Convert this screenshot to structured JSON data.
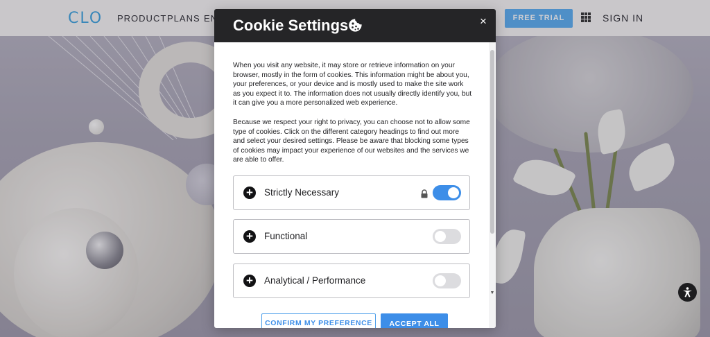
{
  "nav": {
    "logo": "CLO",
    "links": [
      "PRODUCT",
      "PLANS",
      "EN"
    ],
    "free_trial": "FREE TRIAL",
    "sign_in": "SIGN IN"
  },
  "modal": {
    "title": "Cookie Settings",
    "close": "×",
    "paragraphs": [
      "When you visit any website, it may store or retrieve information on your browser, mostly in the form of cookies. This information might be about you, your preferences, or your device and is mostly used to make the site work as you expect it to. The information does not usually directly identify you, but it can give you a more personalized web experience.",
      "Because we respect your right to privacy, you can choose not to allow some type of cookies. Click on the different category headings to find out more and select your desired settings. Please be aware that blocking some types of cookies may impact your experience of our websites and the services we are able to offer."
    ],
    "categories": [
      {
        "label": "Strictly Necessary",
        "enabled": true,
        "locked": true
      },
      {
        "label": "Functional",
        "enabled": false,
        "locked": false
      },
      {
        "label": "Analytical / Performance",
        "enabled": false,
        "locked": false
      }
    ],
    "confirm_button": "CONFIRM MY PREFERENCE",
    "accept_button": "ACCEPT ALL"
  },
  "colors": {
    "accent": "#3d8ee8",
    "header_bg": "#252527",
    "logo": "#3ea3df"
  },
  "icons": [
    "cookie-icon",
    "close-icon",
    "plus-icon",
    "lock-icon",
    "grid-icon",
    "accessibility-icon"
  ]
}
